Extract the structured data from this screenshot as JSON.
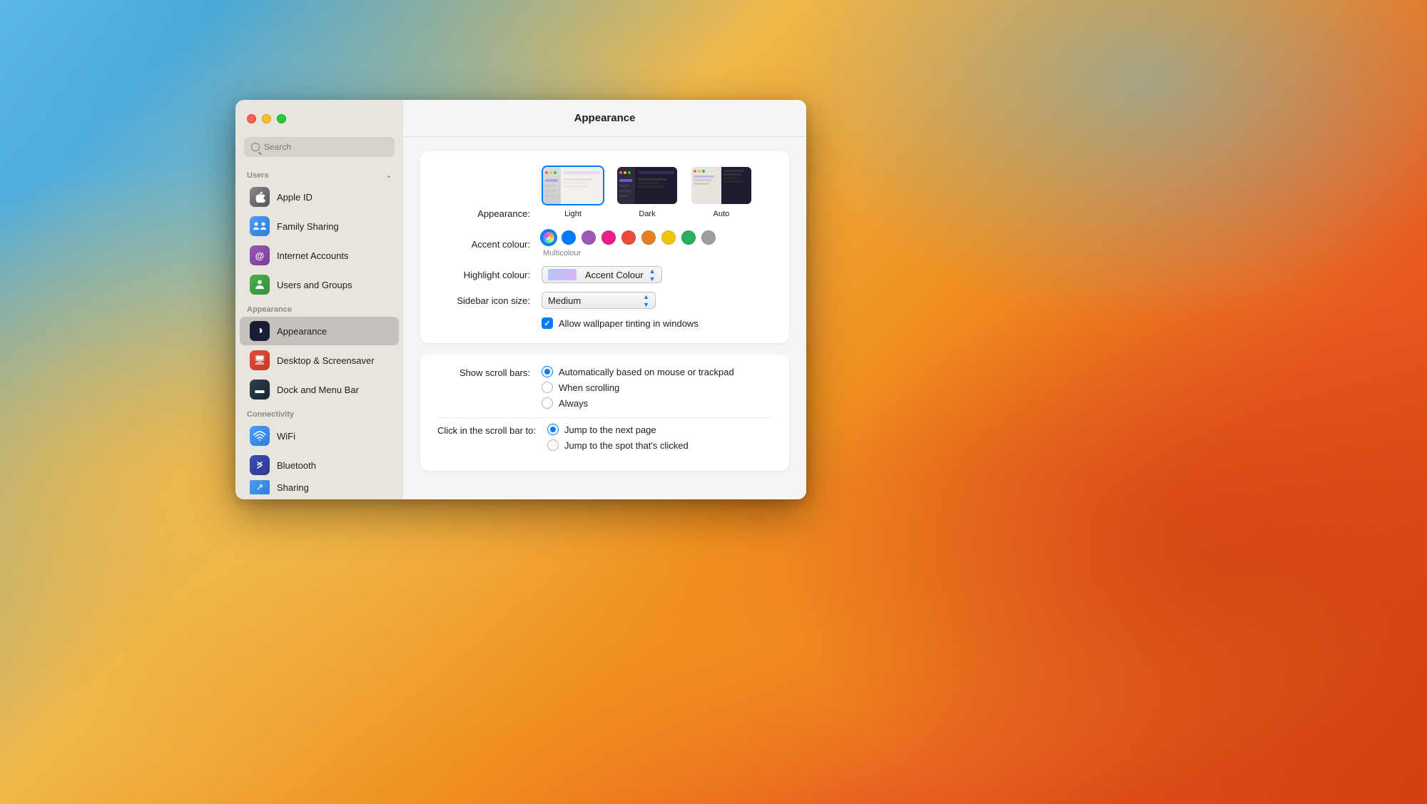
{
  "desktop": {
    "bg_description": "macOS Ventura colorful wallpaper"
  },
  "window": {
    "title": "Appearance",
    "traffic_lights": {
      "close": "close",
      "minimize": "minimize",
      "maximize": "maximize"
    },
    "sidebar": {
      "search_placeholder": "Search",
      "sections": [
        {
          "label": "Users",
          "collapsible": true,
          "items": [
            {
              "id": "apple-id",
              "label": "Apple ID",
              "icon": "apple-id-icon",
              "icon_class": "icon-apple-id",
              "icon_char": "🍎"
            },
            {
              "id": "family-sharing",
              "label": "Family Sharing",
              "icon": "family-icon",
              "icon_class": "icon-family",
              "icon_char": "👨‍👩‍👧"
            },
            {
              "id": "internet-accounts",
              "label": "Internet Accounts",
              "icon": "internet-icon",
              "icon_class": "icon-internet",
              "icon_char": "@"
            },
            {
              "id": "users-groups",
              "label": "Users and Groups",
              "icon": "users-icon",
              "icon_class": "icon-users",
              "icon_char": "👥"
            }
          ]
        },
        {
          "label": "Appearance",
          "collapsible": false,
          "items": [
            {
              "id": "appearance",
              "label": "Appearance",
              "icon": "appearance-icon",
              "icon_class": "icon-appearance",
              "icon_char": "◑",
              "active": true
            },
            {
              "id": "desktop-screensaver",
              "label": "Desktop & Screensaver",
              "icon": "desktop-icon",
              "icon_class": "icon-desktop",
              "icon_char": "🖥"
            },
            {
              "id": "dock-menubar",
              "label": "Dock and Menu Bar",
              "icon": "dock-icon",
              "icon_class": "icon-dock",
              "icon_char": "⬛"
            }
          ]
        },
        {
          "label": "Connectivity",
          "collapsible": false,
          "items": [
            {
              "id": "wifi",
              "label": "WiFi",
              "icon": "wifi-icon",
              "icon_class": "icon-wifi",
              "icon_char": "📶"
            },
            {
              "id": "bluetooth",
              "label": "Bluetooth",
              "icon": "bluetooth-icon",
              "icon_class": "icon-bluetooth",
              "icon_char": "B"
            },
            {
              "id": "sharing",
              "label": "Sharing",
              "icon": "sharing-icon",
              "icon_class": "icon-sharing",
              "icon_char": "↗",
              "partial": true
            }
          ]
        }
      ]
    },
    "main": {
      "title": "Appearance",
      "appearance_section": {
        "appearance_label": "Appearance:",
        "options": [
          {
            "id": "light",
            "label": "Light",
            "selected": true
          },
          {
            "id": "dark",
            "label": "Dark",
            "selected": false
          },
          {
            "id": "auto",
            "label": "Auto",
            "selected": false
          }
        ],
        "accent_colour_label": "Accent colour:",
        "accent_colors": [
          {
            "id": "multicolor",
            "color": "#ff6b9d",
            "label": "Multicolour",
            "selected": true,
            "special": true
          },
          {
            "id": "blue",
            "color": "#007aff",
            "label": "Blue",
            "selected": false
          },
          {
            "id": "purple",
            "color": "#9b59b6",
            "label": "Purple",
            "selected": false
          },
          {
            "id": "pink",
            "color": "#e91e8c",
            "label": "Pink",
            "selected": false
          },
          {
            "id": "red",
            "color": "#e74c3c",
            "label": "Red",
            "selected": false
          },
          {
            "id": "orange",
            "color": "#e67e22",
            "label": "Orange",
            "selected": false
          },
          {
            "id": "yellow",
            "color": "#f1c40f",
            "label": "Yellow",
            "selected": false
          },
          {
            "id": "green",
            "color": "#27ae60",
            "label": "Green",
            "selected": false
          },
          {
            "id": "graphite",
            "color": "#9e9e9e",
            "label": "Graphite",
            "selected": false
          }
        ],
        "multicolor_label": "Multicolour",
        "highlight_colour_label": "Highlight colour:",
        "highlight_value": "Accent Colour",
        "sidebar_icon_size_label": "Sidebar icon size:",
        "sidebar_icon_value": "Medium",
        "wallpaper_tinting_label": "Allow wallpaper tinting in windows",
        "wallpaper_tinting_checked": true
      },
      "scroll_bars_section": {
        "show_scroll_bars_label": "Show scroll bars:",
        "scroll_bar_options": [
          {
            "id": "auto",
            "label": "Automatically based on mouse or trackpad",
            "selected": true
          },
          {
            "id": "scrolling",
            "label": "When scrolling",
            "selected": false
          },
          {
            "id": "always",
            "label": "Always",
            "selected": false
          }
        ],
        "click_scroll_bar_label": "Click in the scroll bar to:",
        "click_scroll_options": [
          {
            "id": "next-page",
            "label": "Jump to the next page",
            "selected": true
          },
          {
            "id": "spot-clicked",
            "label": "Jump to the spot that's clicked",
            "selected": false
          }
        ]
      }
    }
  }
}
